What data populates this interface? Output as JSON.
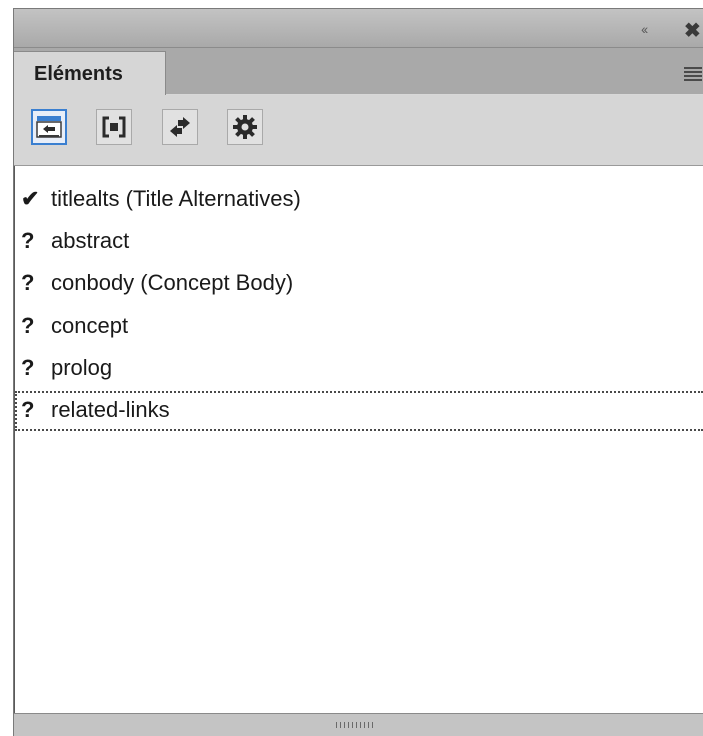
{
  "panel": {
    "title_controls": {
      "collapse_glyph": "‹‹",
      "close_glyph": "✖"
    },
    "tab": {
      "label": "Eléments"
    }
  },
  "toolbar": {
    "buttons": [
      {
        "icon": "swap-display-icon",
        "active": true
      },
      {
        "icon": "element-bracket-icon",
        "active": false
      },
      {
        "icon": "arrows-exchange-icon",
        "active": false
      },
      {
        "icon": "gear-icon",
        "active": false
      }
    ]
  },
  "elements": [
    {
      "mark": "✔",
      "label": "titlealts  (Title Alternatives)"
    },
    {
      "mark": "?",
      "label": "abstract"
    },
    {
      "mark": "?",
      "label": "conbody  (Concept Body)"
    },
    {
      "mark": "?",
      "label": "concept"
    },
    {
      "mark": "?",
      "label": "prolog"
    },
    {
      "mark": "?",
      "label": "related-links"
    }
  ],
  "colors": {
    "accent": "#3a7fd0",
    "panel_bg": "#b6b6b6",
    "list_bg": "#ffffff"
  }
}
